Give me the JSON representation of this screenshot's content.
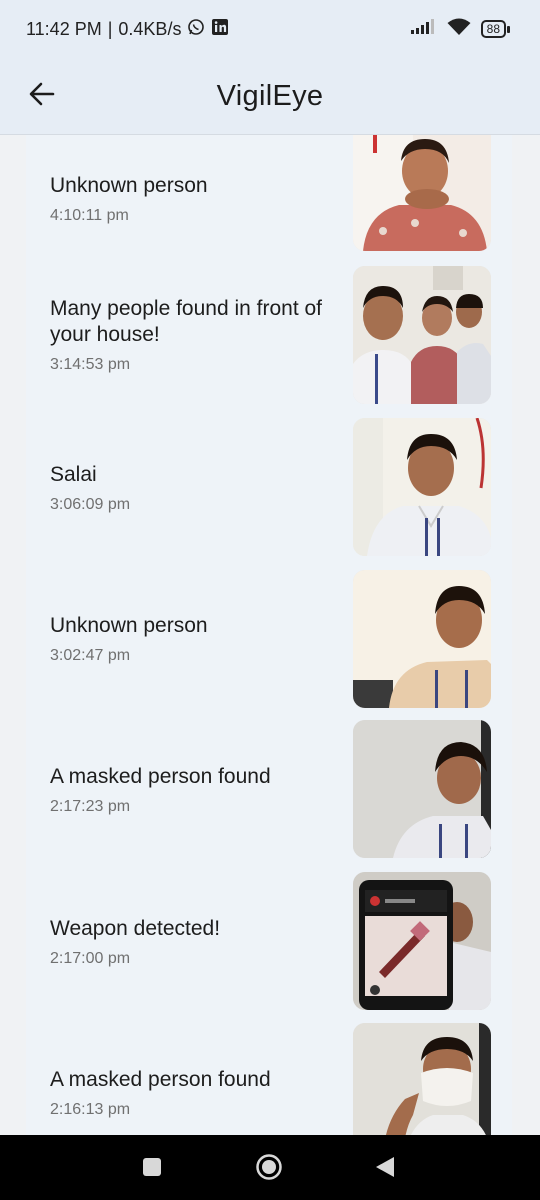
{
  "status_bar": {
    "time": "11:42 PM",
    "separator": "|",
    "net_speed": "0.4KB/s",
    "battery": "88",
    "icons": [
      "whatsapp-icon",
      "linkedin-icon",
      "signal-icon",
      "wifi-icon",
      "battery-icon"
    ]
  },
  "app_bar": {
    "title": "VigilEye",
    "back_icon": "arrow-left-icon"
  },
  "alerts": [
    {
      "title": "Unknown person",
      "time": "4:10:11 pm",
      "image": "person-photo"
    },
    {
      "title": "Many people found in front of your house!",
      "time": "3:14:53 pm",
      "image": "group-photo"
    },
    {
      "title": "Salai",
      "time": "3:06:09 pm",
      "image": "person-photo"
    },
    {
      "title": "Unknown person",
      "time": "3:02:47 pm",
      "image": "person-photo"
    },
    {
      "title": "A masked person found",
      "time": "2:17:23 pm",
      "image": "person-photo"
    },
    {
      "title": "Weapon detected!",
      "time": "2:17:00 pm",
      "image": "phone-with-knife-photo"
    },
    {
      "title": "A masked person found",
      "time": "2:16:13 pm",
      "image": "masked-person-photo"
    }
  ],
  "nav_bar": {
    "icons": [
      "recents-square-icon",
      "home-circle-icon",
      "back-triangle-icon"
    ]
  },
  "colors": {
    "background": "#eef3f8",
    "app_bar": "#e6edf5",
    "title_text": "#1d1d1d",
    "time_text": "#707070",
    "nav_bar": "#000000"
  }
}
